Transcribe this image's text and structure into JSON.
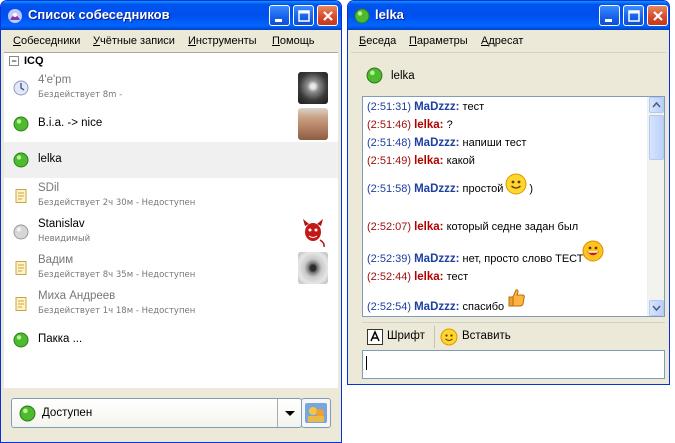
{
  "contacts_window": {
    "title": "Список собеседников",
    "menu": [
      "Собеседники",
      "Учётные записи",
      "Инструменты",
      "Помощь"
    ],
    "group": "ICQ",
    "contacts": [
      {
        "name": "4'e'pm",
        "status": "Бездействует 8m -",
        "icon": "clock-icon",
        "dim": true,
        "avatar": "lamp-avatar"
      },
      {
        "name": "B.i.a. -> nice",
        "status": "",
        "icon": "online-icon",
        "dim": false,
        "avatar": "man-avatar"
      },
      {
        "name": "lelka",
        "status": "",
        "icon": "online-icon",
        "dim": false,
        "selected": true
      },
      {
        "name": "SDil",
        "status": "Бездействует 2ч 30м - Недоступен",
        "icon": "away-note-icon",
        "dim": true
      },
      {
        "name": "Stanislav",
        "status": "Невидимый",
        "icon": "invisible-icon",
        "dim": false,
        "avatar": "devil-avatar"
      },
      {
        "name": "Вадим",
        "status": "Бездействует 8ч 35м - Недоступен",
        "icon": "away-note-icon",
        "dim": true,
        "avatar": "eye-avatar"
      },
      {
        "name": "Миха Андреев",
        "status": "Бездействует 1ч 18м - Недоступен",
        "icon": "away-note-icon",
        "dim": true
      },
      {
        "name": "Пакка ...",
        "status": "",
        "icon": "online-icon",
        "dim": false
      }
    ],
    "status_select": "Доступен"
  },
  "chat_window": {
    "title": "lelka",
    "menu": [
      "Беседа",
      "Параметры",
      "Адресат"
    ],
    "peer_name": "lelka",
    "messages": [
      {
        "time": "(2:51:31)",
        "nick": "MaDzzz:",
        "text": "тест",
        "dir": "out"
      },
      {
        "time": "(2:51:46)",
        "nick": "lelka:",
        "text": "?",
        "dir": "in"
      },
      {
        "time": "(2:51:48)",
        "nick": "MaDzzz:",
        "text": "напиши тест",
        "dir": "out"
      },
      {
        "time": "(2:51:49)",
        "nick": "lelka:",
        "text": "какой",
        "dir": "in"
      },
      {
        "time": "(2:51:58)",
        "nick": "MaDzzz:",
        "text": "простой",
        "dir": "out",
        "smiley": "smile-icon",
        "after": ")"
      },
      {
        "time": "(2:52:07)",
        "nick": "lelka:",
        "text": "который седне задан был",
        "dir": "in"
      },
      {
        "time": "(2:52:39)",
        "nick": "MaDzzz:",
        "text": "нет, просто слово ТЕСТ",
        "dir": "out",
        "smiley": "grin-icon"
      },
      {
        "time": "(2:52:44)",
        "nick": "lelka:",
        "text": "тест",
        "dir": "in"
      },
      {
        "time": "(2:52:54)",
        "nick": "MaDzzz:",
        "text": "спасибо",
        "dir": "out",
        "smiley": "thumbs-up-icon"
      }
    ],
    "toolbar": {
      "font_label": "Шрифт",
      "insert_label": "Вставить"
    },
    "input_value": ""
  },
  "colors": {
    "titlebar": "#0053ee",
    "online": "#3aa829",
    "outgoing_nick": "#1c3fa0",
    "incoming_nick": "#b00000"
  }
}
